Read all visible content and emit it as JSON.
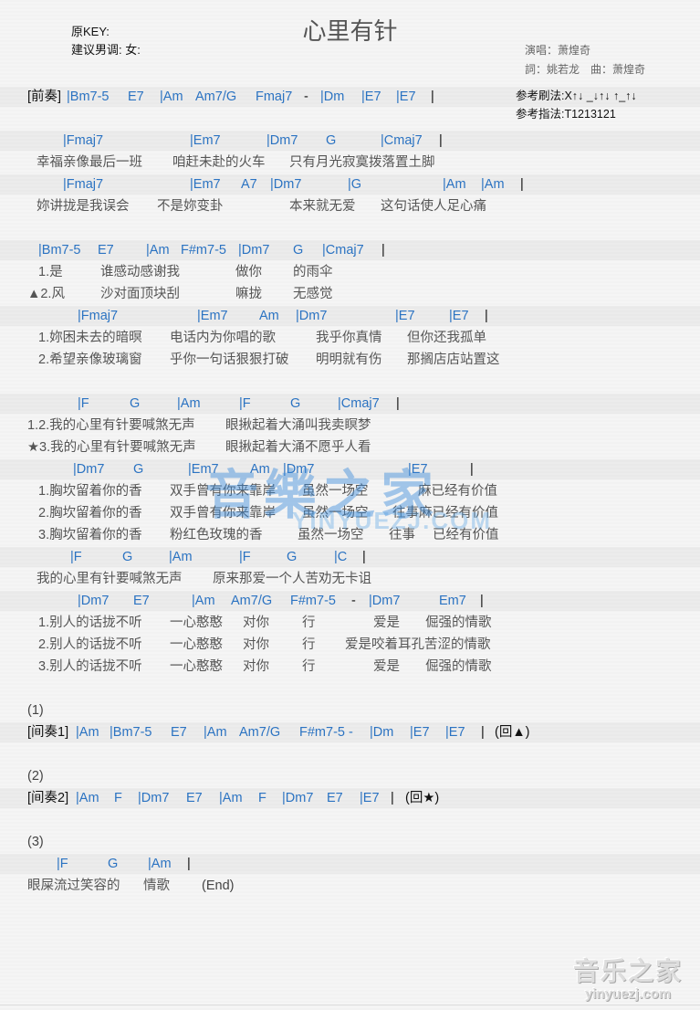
{
  "header": {
    "title": "心里有针",
    "original_key": "原KEY:",
    "suggested_key": "建议男调: 女:",
    "singer": "演唱：萧煌奇",
    "credits": "詞：姚若龙　曲：萧煌奇",
    "strum": "参考刷法:X↑↓ _↓↑↓ ↑_↑↓",
    "pick": "参考指法:T1213121"
  },
  "rows": [
    {
      "type": "chord",
      "segments": [
        "[前奏]",
        "|Bm7-5",
        "E7",
        "|Am",
        "Am7/G",
        "Fmaj7",
        "-",
        "|Dm",
        "|E7",
        "|E7",
        "|"
      ]
    },
    {
      "type": "chord",
      "segments": [
        "|Fmaj7",
        "|Em7",
        "|Dm7",
        "G",
        "|Cmaj7",
        "|"
      ]
    },
    {
      "type": "lyric",
      "segments": [
        "幸福亲像最后一班",
        "咱赶未赴的火车",
        "只有月光寂寞拨落置土脚"
      ]
    },
    {
      "type": "chord",
      "segments": [
        "|Fmaj7",
        "|Em7",
        "A7",
        "|Dm7",
        "|G",
        "|Am",
        "|Am",
        "|"
      ]
    },
    {
      "type": "lyric",
      "segments": [
        "妳讲拢是我误会",
        "不是妳变卦",
        "本来就无爱",
        "这句话使人足心痛"
      ]
    },
    {
      "type": "chord",
      "segments": [
        "|Bm7-5",
        "E7",
        "|Am",
        "F#m7-5",
        "|Dm7",
        "G",
        "|Cmaj7",
        "|"
      ]
    },
    {
      "type": "lyric",
      "segments": [
        "1.是",
        "谁感动感谢我",
        "做你",
        "的雨伞"
      ]
    },
    {
      "type": "lyric",
      "segments": [
        "▲2.风",
        "沙对面顶块刮",
        "嘛拢",
        "无感觉"
      ]
    },
    {
      "type": "chord",
      "segments": [
        "|Fmaj7",
        "|Em7",
        "Am",
        "|Dm7",
        "|E7",
        "|E7",
        "|"
      ]
    },
    {
      "type": "lyric",
      "segments": [
        "1.妳困未去的暗暝",
        "电话内为你唱的歌",
        "我乎你真情",
        "但你还我孤单"
      ]
    },
    {
      "type": "lyric",
      "segments": [
        "2.希望亲像玻璃窗",
        "乎你一句话狠狠打破",
        "明明就有伤",
        "那搁店店站置这"
      ]
    },
    {
      "type": "chord",
      "segments": [
        "|F",
        "G",
        "|Am",
        "|F",
        "G",
        "|Cmaj7",
        "|"
      ]
    },
    {
      "type": "lyric",
      "segments": [
        "1.2.我的心里有针要喊煞无声",
        "眼揪起着大涌叫我卖瞑梦"
      ]
    },
    {
      "type": "lyric",
      "segments": [
        "★3.我的心里有针要喊煞无声",
        "眼揪起着大涌不愿乎人看"
      ]
    },
    {
      "type": "chord",
      "segments": [
        "|Dm7",
        "G",
        "|Em7",
        "Am",
        "|Dm7",
        "|E7",
        "|"
      ]
    },
    {
      "type": "lyric",
      "segments": [
        "1.胸坎留着你的香",
        "双手曾有你来靠岸",
        "虽然一场空",
        "麻已经有价值"
      ]
    },
    {
      "type": "lyric",
      "segments": [
        "2.胸坎留着你的香",
        "双手曾有你来靠岸",
        "虽然一场空",
        "往事麻已经有价值"
      ]
    },
    {
      "type": "lyric",
      "segments": [
        "3.胸坎留着你的香",
        "粉红色玫瑰的香",
        "虽然一场空",
        "往事",
        "已经有价值"
      ]
    },
    {
      "type": "chord",
      "segments": [
        "|F",
        "G",
        "|Am",
        "|F",
        "G",
        "|C",
        "|"
      ]
    },
    {
      "type": "lyric",
      "segments": [
        "我的心里有针要喊煞无声",
        "原来那爱一个人苦劝无卡诅"
      ]
    },
    {
      "type": "chord",
      "segments": [
        "|Dm7",
        "E7",
        "|Am",
        "Am7/G",
        "F#m7-5",
        "-",
        "|Dm7",
        "Em7",
        "|"
      ]
    },
    {
      "type": "lyric",
      "segments": [
        "1.别人的话拢不听",
        "一心憨憨",
        "对你",
        "行",
        "爱是",
        "倔强的情歌"
      ]
    },
    {
      "type": "lyric",
      "segments": [
        "2.别人的话拢不听",
        "一心憨憨",
        "对你",
        "行",
        "爱是咬着耳孔苦涩的情歌"
      ]
    },
    {
      "type": "lyric",
      "segments": [
        "3.别人的话拢不听",
        "一心憨憨",
        "对你",
        "行",
        "爱是",
        "倔强的情歌"
      ]
    },
    {
      "type": "lyric",
      "segments": [
        "(1)"
      ]
    },
    {
      "type": "chord",
      "segments": [
        "[间奏1]",
        "|Am",
        "|Bm7-5",
        "E7",
        "|Am",
        "Am7/G",
        "F#m7-5 -",
        "|Dm",
        "|E7",
        "|E7",
        "|",
        "(回▲)"
      ]
    },
    {
      "type": "lyric",
      "segments": [
        "(2)"
      ]
    },
    {
      "type": "chord",
      "segments": [
        "[间奏2]",
        "|Am",
        "F",
        "|Dm7",
        "E7",
        "|Am",
        "F",
        "|Dm7",
        "E7",
        "|E7",
        "|",
        "(回★)"
      ]
    },
    {
      "type": "lyric",
      "segments": [
        "(3)"
      ]
    },
    {
      "type": "chord",
      "segments": [
        "|F",
        "G",
        "|Am",
        "|"
      ]
    },
    {
      "type": "lyric",
      "segments": [
        "眼屎流过笑容的",
        "情歌",
        "(End)"
      ]
    }
  ],
  "watermark": {
    "main": "音樂之家",
    "sub": "YINYUEZJ.COM"
  },
  "logo": {
    "main": "音乐之家",
    "sub": "yinyuezj.com"
  },
  "colors": {
    "chord": "#2b73c2",
    "lyric": "#555555",
    "background": "#f5f5f5"
  }
}
